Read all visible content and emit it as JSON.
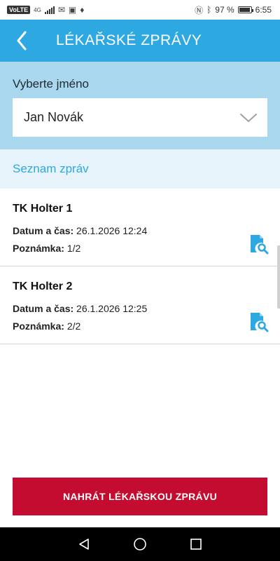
{
  "status_bar": {
    "carrier_badge": "VoLTE",
    "network": "4G",
    "battery_percent": "97 %",
    "time": "6:55"
  },
  "app_bar": {
    "title": "LÉKAŘSKÉ ZPRÁVY",
    "back_icon": "chevron-left-icon"
  },
  "selector": {
    "label": "Vyberte jméno",
    "selected": "Jan Novák"
  },
  "list": {
    "header": "Seznam zpráv",
    "date_label": "Datum a čas:",
    "note_label": "Poznámka:",
    "items": [
      {
        "title": "TK Holter 1",
        "datetime": "26.1.2026 12:24",
        "note": "1/2"
      },
      {
        "title": "TK Holter 2",
        "datetime": "26.1.2026 12:25",
        "note": "2/2"
      }
    ]
  },
  "upload_button": {
    "label": "NAHRÁT LÉKAŘSKOU ZPRÁVU"
  },
  "colors": {
    "primary": "#2ea8e0",
    "selector_bg": "#a9d8ee",
    "list_header_bg": "#e6f3fa",
    "accent_red": "#c30c2f"
  }
}
